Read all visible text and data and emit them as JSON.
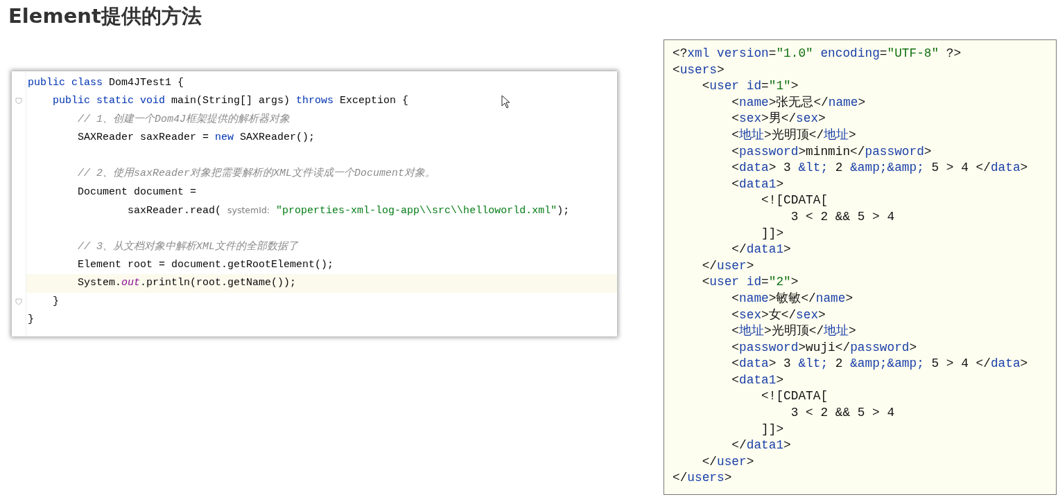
{
  "title": "Element提供的方法",
  "java_editor": {
    "lines": [
      {
        "kind": "code",
        "fold": false,
        "current": false,
        "tokens": [
          {
            "kind": "keyword",
            "text": "public class"
          },
          {
            "kind": "plain",
            "text": " Dom4JTest1 {"
          }
        ]
      },
      {
        "kind": "code",
        "fold": true,
        "current": false,
        "tokens": [
          {
            "kind": "keyword",
            "text": "    public static void"
          },
          {
            "kind": "plain",
            "text": " main(String[] args) "
          },
          {
            "kind": "keyword",
            "text": "throws"
          },
          {
            "kind": "plain",
            "text": " Exception {"
          }
        ]
      },
      {
        "kind": "code",
        "fold": false,
        "current": false,
        "tokens": [
          {
            "kind": "comment",
            "text": "        // 1、创建一个Dom4J框架提供的解析器对象"
          }
        ]
      },
      {
        "kind": "code",
        "fold": false,
        "current": false,
        "tokens": [
          {
            "kind": "plain",
            "text": "        SAXReader saxReader = "
          },
          {
            "kind": "keyword",
            "text": "new"
          },
          {
            "kind": "plain",
            "text": " SAXReader();"
          }
        ]
      },
      {
        "kind": "blank"
      },
      {
        "kind": "code",
        "fold": false,
        "current": false,
        "tokens": [
          {
            "kind": "comment",
            "text": "        // 2、使用saxReader对象把需要解析的XML文件读成一个Document对象。"
          }
        ]
      },
      {
        "kind": "code",
        "fold": false,
        "current": false,
        "tokens": [
          {
            "kind": "plain",
            "text": "        Document document ="
          }
        ]
      },
      {
        "kind": "code",
        "fold": false,
        "current": false,
        "tokens": [
          {
            "kind": "plain",
            "text": "                saxReader.read( "
          },
          {
            "kind": "hint",
            "text": "systemId:"
          },
          {
            "kind": "string",
            "text": " \"properties-xml-log-app\\\\src\\\\helloworld.xml\""
          },
          {
            "kind": "plain",
            "text": ");"
          }
        ]
      },
      {
        "kind": "blank"
      },
      {
        "kind": "code",
        "fold": false,
        "current": false,
        "tokens": [
          {
            "kind": "comment",
            "text": "        // 3、从文档对象中解析XML文件的全部数据了"
          }
        ]
      },
      {
        "kind": "code",
        "fold": false,
        "current": false,
        "tokens": [
          {
            "kind": "plain",
            "text": "        Element root = document.getRootElement();"
          }
        ]
      },
      {
        "kind": "code",
        "fold": false,
        "current": true,
        "tokens": [
          {
            "kind": "plain",
            "text": "        System."
          },
          {
            "kind": "field",
            "text": "out"
          },
          {
            "kind": "plain",
            "text": ".println(root.getName());"
          }
        ]
      },
      {
        "kind": "code",
        "fold": true,
        "current": false,
        "tokens": [
          {
            "kind": "plain",
            "text": "    }"
          }
        ]
      },
      {
        "kind": "code",
        "fold": false,
        "current": false,
        "tokens": [
          {
            "kind": "plain",
            "text": "}"
          }
        ]
      }
    ]
  },
  "xml_panel": {
    "lines": [
      [
        {
          "kind": "text",
          "text": "<?"
        },
        {
          "kind": "markup",
          "text": "xml version"
        },
        {
          "kind": "text",
          "text": "="
        },
        {
          "kind": "value",
          "text": "\"1.0\""
        },
        {
          "kind": "markup",
          "text": " encoding"
        },
        {
          "kind": "text",
          "text": "="
        },
        {
          "kind": "value",
          "text": "\"UTF-8\""
        },
        {
          "kind": "text",
          "text": " ?>"
        }
      ],
      [
        {
          "kind": "text",
          "text": "<"
        },
        {
          "kind": "markup",
          "text": "users"
        },
        {
          "kind": "text",
          "text": ">"
        }
      ],
      [
        {
          "kind": "text",
          "text": "    <"
        },
        {
          "kind": "markup",
          "text": "user id"
        },
        {
          "kind": "text",
          "text": "="
        },
        {
          "kind": "value",
          "text": "\"1\""
        },
        {
          "kind": "text",
          "text": ">"
        }
      ],
      [
        {
          "kind": "text",
          "text": "        <"
        },
        {
          "kind": "markup",
          "text": "name"
        },
        {
          "kind": "text",
          "text": ">张无忌</"
        },
        {
          "kind": "markup",
          "text": "name"
        },
        {
          "kind": "text",
          "text": ">"
        }
      ],
      [
        {
          "kind": "text",
          "text": "        <"
        },
        {
          "kind": "markup",
          "text": "sex"
        },
        {
          "kind": "text",
          "text": ">男</"
        },
        {
          "kind": "markup",
          "text": "sex"
        },
        {
          "kind": "text",
          "text": ">"
        }
      ],
      [
        {
          "kind": "text",
          "text": "        <"
        },
        {
          "kind": "markup",
          "text": "地址"
        },
        {
          "kind": "text",
          "text": ">光明顶</"
        },
        {
          "kind": "markup",
          "text": "地址"
        },
        {
          "kind": "text",
          "text": ">"
        }
      ],
      [
        {
          "kind": "text",
          "text": "        <"
        },
        {
          "kind": "markup",
          "text": "password"
        },
        {
          "kind": "text",
          "text": ">minmin</"
        },
        {
          "kind": "markup",
          "text": "password"
        },
        {
          "kind": "text",
          "text": ">"
        }
      ],
      [
        {
          "kind": "text",
          "text": "        <"
        },
        {
          "kind": "markup",
          "text": "data"
        },
        {
          "kind": "text",
          "text": "> 3 "
        },
        {
          "kind": "markup",
          "text": "&lt;"
        },
        {
          "kind": "text",
          "text": " 2 "
        },
        {
          "kind": "markup",
          "text": "&amp;&amp;"
        },
        {
          "kind": "text",
          "text": " 5 > 4 </"
        },
        {
          "kind": "markup",
          "text": "data"
        },
        {
          "kind": "text",
          "text": ">"
        }
      ],
      [
        {
          "kind": "text",
          "text": "        <"
        },
        {
          "kind": "markup",
          "text": "data1"
        },
        {
          "kind": "text",
          "text": ">"
        }
      ],
      [
        {
          "kind": "text",
          "text": "            <![CDATA["
        }
      ],
      [
        {
          "kind": "text",
          "text": "                3 < 2 && 5 > 4"
        }
      ],
      [
        {
          "kind": "text",
          "text": "            ]]>"
        }
      ],
      [
        {
          "kind": "text",
          "text": "        </"
        },
        {
          "kind": "markup",
          "text": "data1"
        },
        {
          "kind": "text",
          "text": ">"
        }
      ],
      [
        {
          "kind": "text",
          "text": "    </"
        },
        {
          "kind": "markup",
          "text": "user"
        },
        {
          "kind": "text",
          "text": ">"
        }
      ],
      [
        {
          "kind": "text",
          "text": "    <"
        },
        {
          "kind": "markup",
          "text": "user id"
        },
        {
          "kind": "text",
          "text": "="
        },
        {
          "kind": "value",
          "text": "\"2\""
        },
        {
          "kind": "text",
          "text": ">"
        }
      ],
      [
        {
          "kind": "text",
          "text": "        <"
        },
        {
          "kind": "markup",
          "text": "name"
        },
        {
          "kind": "text",
          "text": ">敏敏</"
        },
        {
          "kind": "markup",
          "text": "name"
        },
        {
          "kind": "text",
          "text": ">"
        }
      ],
      [
        {
          "kind": "text",
          "text": "        <"
        },
        {
          "kind": "markup",
          "text": "sex"
        },
        {
          "kind": "text",
          "text": ">女</"
        },
        {
          "kind": "markup",
          "text": "sex"
        },
        {
          "kind": "text",
          "text": ">"
        }
      ],
      [
        {
          "kind": "text",
          "text": "        <"
        },
        {
          "kind": "markup",
          "text": "地址"
        },
        {
          "kind": "text",
          "text": ">光明顶</"
        },
        {
          "kind": "markup",
          "text": "地址"
        },
        {
          "kind": "text",
          "text": ">"
        }
      ],
      [
        {
          "kind": "text",
          "text": "        <"
        },
        {
          "kind": "markup",
          "text": "password"
        },
        {
          "kind": "text",
          "text": ">wuji</"
        },
        {
          "kind": "markup",
          "text": "password"
        },
        {
          "kind": "text",
          "text": ">"
        }
      ],
      [
        {
          "kind": "text",
          "text": "        <"
        },
        {
          "kind": "markup",
          "text": "data"
        },
        {
          "kind": "text",
          "text": "> 3 "
        },
        {
          "kind": "markup",
          "text": "&lt;"
        },
        {
          "kind": "text",
          "text": " 2 "
        },
        {
          "kind": "markup",
          "text": "&amp;&amp;"
        },
        {
          "kind": "text",
          "text": " 5 > 4 </"
        },
        {
          "kind": "markup",
          "text": "data"
        },
        {
          "kind": "text",
          "text": ">"
        }
      ],
      [
        {
          "kind": "text",
          "text": "        <"
        },
        {
          "kind": "markup",
          "text": "data1"
        },
        {
          "kind": "text",
          "text": ">"
        }
      ],
      [
        {
          "kind": "text",
          "text": "            <![CDATA["
        }
      ],
      [
        {
          "kind": "text",
          "text": "                3 < 2 && 5 > 4"
        }
      ],
      [
        {
          "kind": "text",
          "text": "            ]]>"
        }
      ],
      [
        {
          "kind": "text",
          "text": "        </"
        },
        {
          "kind": "markup",
          "text": "data1"
        },
        {
          "kind": "text",
          "text": ">"
        }
      ],
      [
        {
          "kind": "text",
          "text": "    </"
        },
        {
          "kind": "markup",
          "text": "user"
        },
        {
          "kind": "text",
          "text": ">"
        }
      ],
      [
        {
          "kind": "text",
          "text": "</"
        },
        {
          "kind": "markup",
          "text": "users"
        },
        {
          "kind": "text",
          "text": ">"
        }
      ]
    ]
  }
}
